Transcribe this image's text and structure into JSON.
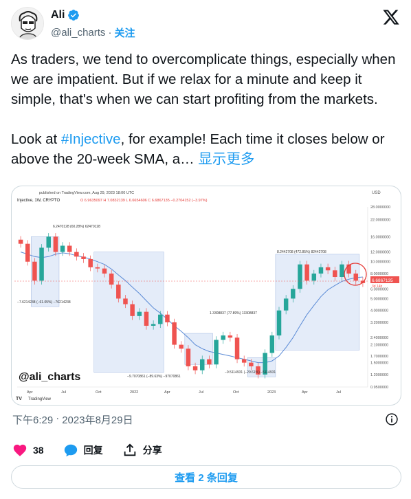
{
  "author": {
    "display_name": "Ali",
    "handle": "@ali_charts",
    "separator": "·",
    "follow_label": "关注"
  },
  "tweet": {
    "paragraph1": "As traders, we tend to overcomplicate things, especially when we are impatient. But if we relax for a minute and keep it simple, that's when we can start profiting from the markets.",
    "paragraph2_before": "Look at ",
    "hashtag": "#Injective",
    "paragraph2_after": ", for example! Each time it closes below or above the 20-week SMA, a… ",
    "show_more": "显示更多"
  },
  "chart_data": {
    "type": "candlestick",
    "published_line": "published on TradingView.com, Aug 29, 2023 18:00 UTC",
    "symbol_line": "Injective, 1W, CRYPTO",
    "ohlc_text": "O 6.9635097  H 7.0832139  L 6.6654606  C 6.6867135  −0.2704152 (−3.97%)",
    "currency": "USD",
    "y_axis_labels": [
      "28.0000000",
      "22.0000000",
      "16.0000000",
      "12.0000000",
      "10.0000000",
      "8.0000000",
      "6.0000000",
      "5.0000000",
      "4.0000000",
      "3.2000000",
      "2.4000000",
      "2.1000000",
      "1.7000000",
      "1.5000000",
      "1.2000000",
      "0.9500000"
    ],
    "x_axis_labels": [
      "Apr",
      "Jul",
      "Oct",
      "2022",
      "Apr",
      "Jul",
      "Oct",
      "2023",
      "Apr",
      "Jul"
    ],
    "price_tag": "6.6867135",
    "price_tag_sub": "3d 14h",
    "annotations": [
      "6.2470128 (60.28%) 62470128",
      "−7.6214238 (−61.05%) −76214238",
      "−9.7070861 (−89.63%) −97070861",
      "1.3308837 (77.89%) 13308837",
      "−0.5114931 (−29.61%) −5114931",
      "8.2442708 (472.85%) 82442708"
    ],
    "watermark": "@ali_charts",
    "logo_text": "TradingView",
    "series": [
      {
        "name": "price",
        "values": [
          14.0,
          10.0,
          7.0,
          13.0,
          16.0,
          12.0,
          13.5,
          12.0,
          11.0,
          10.5,
          9.0,
          8.8,
          8.0,
          6.5,
          5.0,
          4.5,
          3.6,
          3.9,
          3.0,
          3.1,
          3.7,
          3.2,
          2.1,
          1.95,
          1.4,
          1.3,
          1.6,
          1.45,
          2.3,
          2.5,
          2.4,
          1.6,
          1.5,
          1.4,
          1.2,
          1.8,
          2.5,
          4.0,
          5.0,
          6.0,
          9.5,
          7.0,
          8.0,
          9.0,
          8.5,
          7.5,
          9.5,
          8.0,
          7.0,
          6.69
        ]
      },
      {
        "name": "SMA 20",
        "values": [
          12.0,
          11.5,
          11.0,
          10.8,
          11.0,
          11.5,
          11.8,
          11.6,
          11.2,
          10.9,
          10.5,
          10.0,
          9.5,
          8.7,
          7.8,
          7.0,
          6.2,
          5.5,
          4.8,
          4.2,
          3.8,
          3.4,
          3.0,
          2.7,
          2.4,
          2.1,
          1.95,
          1.85,
          1.8,
          1.75,
          1.7,
          1.65,
          1.6,
          1.55,
          1.5,
          1.5,
          1.55,
          1.7,
          2.0,
          2.4,
          3.0,
          3.7,
          4.4,
          5.2,
          5.9,
          6.4,
          6.9,
          7.2,
          7.4,
          7.5
        ]
      }
    ]
  },
  "timestamp": {
    "time": "下午6:29",
    "separator": "·",
    "date": "2023年8月29日"
  },
  "actions": {
    "likes": "38",
    "reply_label": "回复",
    "share_label": "分享"
  },
  "replies_button": "查看 2 条回复",
  "colors": {
    "accent": "#1d9bf0",
    "like": "#f91880",
    "up_candle": "#26a69a",
    "down_candle": "#ef5350",
    "highlight_box": "#dbe5f7"
  },
  "icons": [
    "verified-badge-icon",
    "x-logo-icon",
    "info-icon",
    "heart-icon",
    "reply-icon",
    "share-icon"
  ]
}
